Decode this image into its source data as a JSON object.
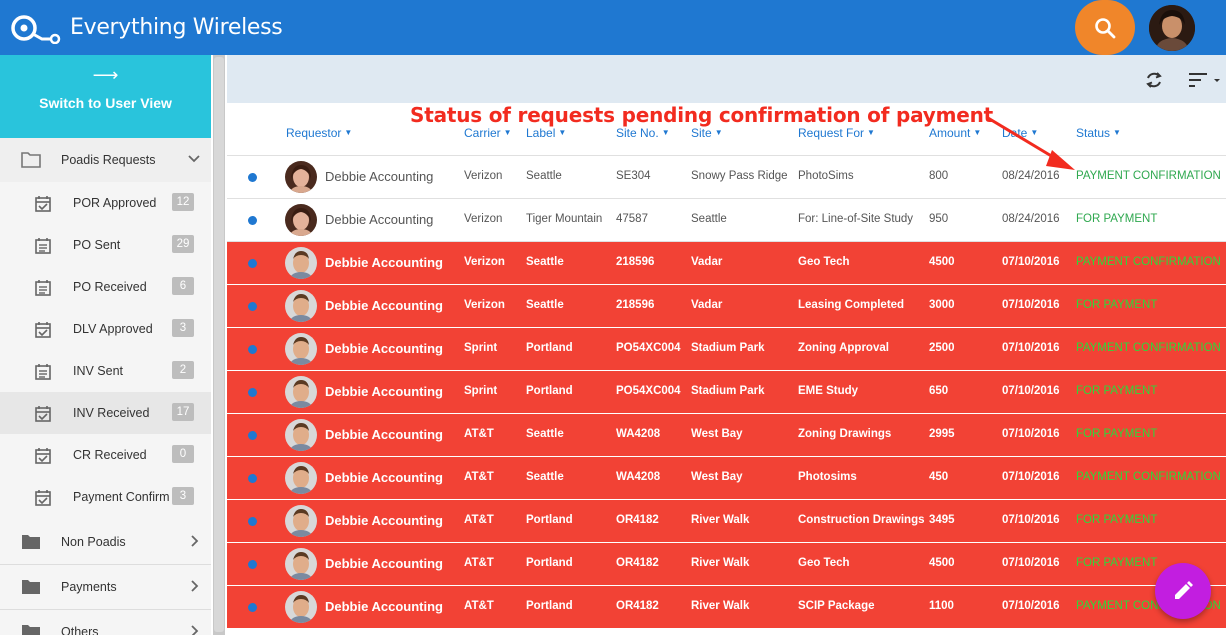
{
  "header": {
    "app_title": "Everything Wireless",
    "search_icon": "search-icon",
    "avatar": "user-avatar"
  },
  "sidebar": {
    "switch_arrow": "⟶",
    "switch_label": "Switch to User View",
    "poadis_group": {
      "label": "Poadis Requests",
      "icon": "folder-open-icon",
      "expanded": true
    },
    "items": [
      {
        "label": "POR Approved",
        "count": "12",
        "icon": "calendar-check-icon"
      },
      {
        "label": "PO Sent",
        "count": "29",
        "icon": "note-icon"
      },
      {
        "label": "PO Received",
        "count": "6",
        "icon": "note-icon"
      },
      {
        "label": "DLV Approved",
        "count": "3",
        "icon": "calendar-check-icon"
      },
      {
        "label": "INV Sent",
        "count": "2",
        "icon": "note-icon"
      },
      {
        "label": "INV Received",
        "count": "17",
        "icon": "calendar-check-icon",
        "active": true
      },
      {
        "label": "CR Received",
        "count": "0",
        "icon": "calendar-check-icon"
      },
      {
        "label": "Payment Confirm",
        "count": "3",
        "icon": "calendar-check-icon"
      }
    ],
    "non_poadis_label": "Non Poadis",
    "payments_label": "Payments",
    "others_label": "Others"
  },
  "toolbar": {
    "refresh_icon": "refresh-icon",
    "sort_icon": "sort-icon"
  },
  "table": {
    "columns": [
      "Requestor",
      "Carrier",
      "Label",
      "Site No.",
      "Site",
      "Request For",
      "Amount",
      "Date",
      "Status"
    ],
    "rows": [
      {
        "style": "white",
        "requestor": "Debbie Accounting",
        "carrier": "Verizon",
        "label": "Seattle",
        "site_no": "SE304",
        "site": "Snowy Pass Ridge",
        "request_for": "PhotoSims",
        "amount": "800",
        "date": "08/24/2016",
        "status": "PAYMENT CONFIRMATION"
      },
      {
        "style": "white",
        "requestor": "Debbie Accounting",
        "carrier": "Verizon",
        "label": "Tiger Mountain",
        "site_no": "47587",
        "site": "Seattle",
        "request_for": "For: Line-of-Site Study",
        "amount": "950",
        "date": "08/24/2016",
        "status": "FOR PAYMENT"
      },
      {
        "style": "red",
        "requestor": "Debbie Accounting",
        "carrier": "Verizon",
        "label": "Seattle",
        "site_no": "218596",
        "site": "Vadar",
        "request_for": "Geo Tech",
        "amount": "4500",
        "date": "07/10/2016",
        "status": "PAYMENT CONFIRMATION"
      },
      {
        "style": "red",
        "requestor": "Debbie Accounting",
        "carrier": "Verizon",
        "label": "Seattle",
        "site_no": "218596",
        "site": "Vadar",
        "request_for": "Leasing Completed",
        "amount": "3000",
        "date": "07/10/2016",
        "status": "FOR PAYMENT"
      },
      {
        "style": "red",
        "requestor": "Debbie Accounting",
        "carrier": "Sprint",
        "label": "Portland",
        "site_no": "PO54XC004",
        "site": "Stadium Park",
        "request_for": "Zoning Approval",
        "amount": "2500",
        "date": "07/10/2016",
        "status": "PAYMENT CONFIRMATION"
      },
      {
        "style": "red",
        "requestor": "Debbie Accounting",
        "carrier": "Sprint",
        "label": "Portland",
        "site_no": "PO54XC004",
        "site": "Stadium Park",
        "request_for": "EME Study",
        "amount": "650",
        "date": "07/10/2016",
        "status": "FOR PAYMENT"
      },
      {
        "style": "red",
        "requestor": "Debbie Accounting",
        "carrier": "AT&T",
        "label": "Seattle",
        "site_no": "WA4208",
        "site": "West Bay",
        "request_for": "Zoning Drawings",
        "amount": "2995",
        "date": "07/10/2016",
        "status": "FOR PAYMENT"
      },
      {
        "style": "red",
        "requestor": "Debbie Accounting",
        "carrier": "AT&T",
        "label": "Seattle",
        "site_no": "WA4208",
        "site": "West Bay",
        "request_for": "Photosims",
        "amount": "450",
        "date": "07/10/2016",
        "status": "PAYMENT CONFIRMATION"
      },
      {
        "style": "red",
        "requestor": "Debbie Accounting",
        "carrier": "AT&T",
        "label": "Portland",
        "site_no": "OR4182",
        "site": "River Walk",
        "request_for": "Construction Drawings",
        "amount": "3495",
        "date": "07/10/2016",
        "status": "FOR PAYMENT"
      },
      {
        "style": "red",
        "requestor": "Debbie Accounting",
        "carrier": "AT&T",
        "label": "Portland",
        "site_no": "OR4182",
        "site": "River Walk",
        "request_for": "Geo Tech",
        "amount": "4500",
        "date": "07/10/2016",
        "status": "FOR PAYMENT"
      },
      {
        "style": "red",
        "requestor": "Debbie Accounting",
        "carrier": "AT&T",
        "label": "Portland",
        "site_no": "OR4182",
        "site": "River Walk",
        "request_for": "SCIP Package",
        "amount": "1100",
        "date": "07/10/2016",
        "status": "PAYMENT CONFIRMATION"
      }
    ]
  },
  "annotation": {
    "text": "Status of requests pending confirmation of payment"
  },
  "fab": {
    "icon": "pencil-icon"
  },
  "colors": {
    "topbar": "#1f78d1",
    "search_button": "#f0862a",
    "switch_button": "#29c4dc",
    "highlight_row": "#f24235",
    "status_green": "#2fd73a",
    "annotation": "#f22b1f",
    "fab": "#c21ee0"
  }
}
